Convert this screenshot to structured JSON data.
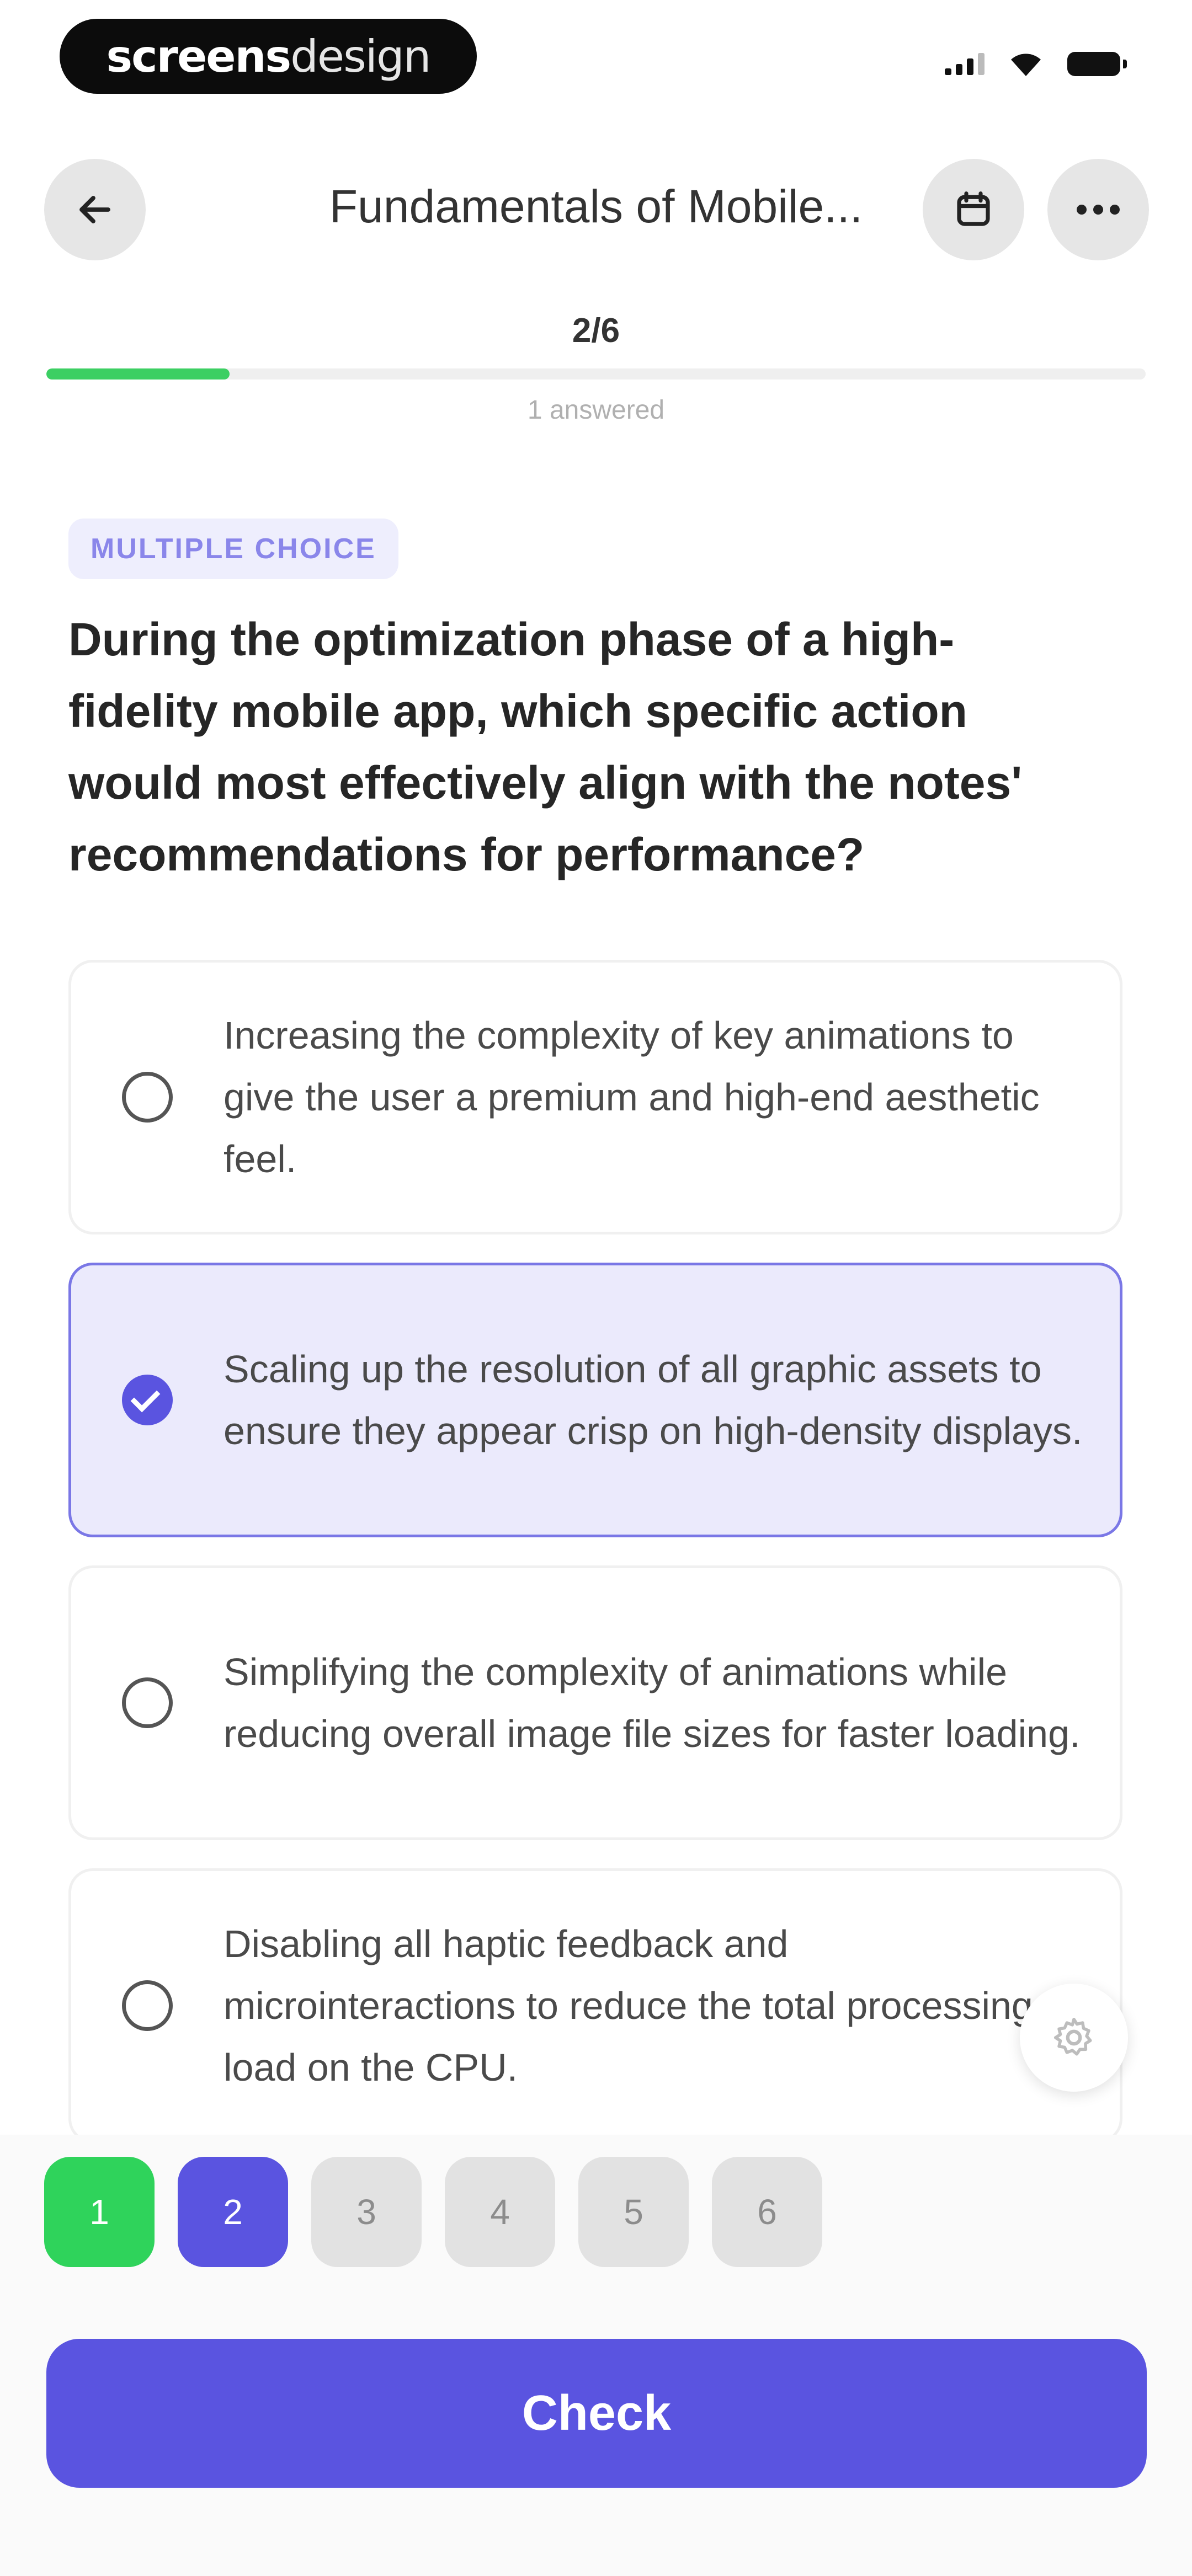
{
  "status_bar": {
    "brand_bold": "screens",
    "brand_light": "design"
  },
  "header": {
    "title": "Fundamentals of Mobile...",
    "back_icon": "arrow-left-icon",
    "calendar_icon": "calendar-icon",
    "more_icon": "ellipsis-icon"
  },
  "progress": {
    "counter": "2/6",
    "fraction": 0.1667,
    "answered_text": "1 answered"
  },
  "question": {
    "type_label": "MULTIPLE CHOICE",
    "text": "During the optimization phase of a high-fidelity mobile app, which specific action would most effectively align with the notes' recommendations for performance?",
    "options": [
      {
        "text": "Increasing the complexity of key animations to give the user a premium and high-end aesthetic feel.",
        "selected": false
      },
      {
        "text": "Scaling up the resolution of all graphic assets to ensure they appear crisp on high-density displays.",
        "selected": true
      },
      {
        "text": "Simplifying the complexity of animations while reducing overall image file sizes for faster loading.",
        "selected": false
      },
      {
        "text": "Disabling all haptic feedback and microinteractions to reduce the total processing load on the CPU.",
        "selected": false
      }
    ]
  },
  "question_nav": [
    {
      "label": "1",
      "state": "done"
    },
    {
      "label": "2",
      "state": "current"
    },
    {
      "label": "3",
      "state": "pending"
    },
    {
      "label": "4",
      "state": "pending"
    },
    {
      "label": "5",
      "state": "pending"
    },
    {
      "label": "6",
      "state": "pending"
    }
  ],
  "actions": {
    "check_label": "Check",
    "settings_icon": "gear-icon"
  },
  "colors": {
    "accent": "#5a54e0",
    "success": "#2fd35b",
    "progress": "#3ccf63",
    "selected_bg": "#ebeafc"
  }
}
